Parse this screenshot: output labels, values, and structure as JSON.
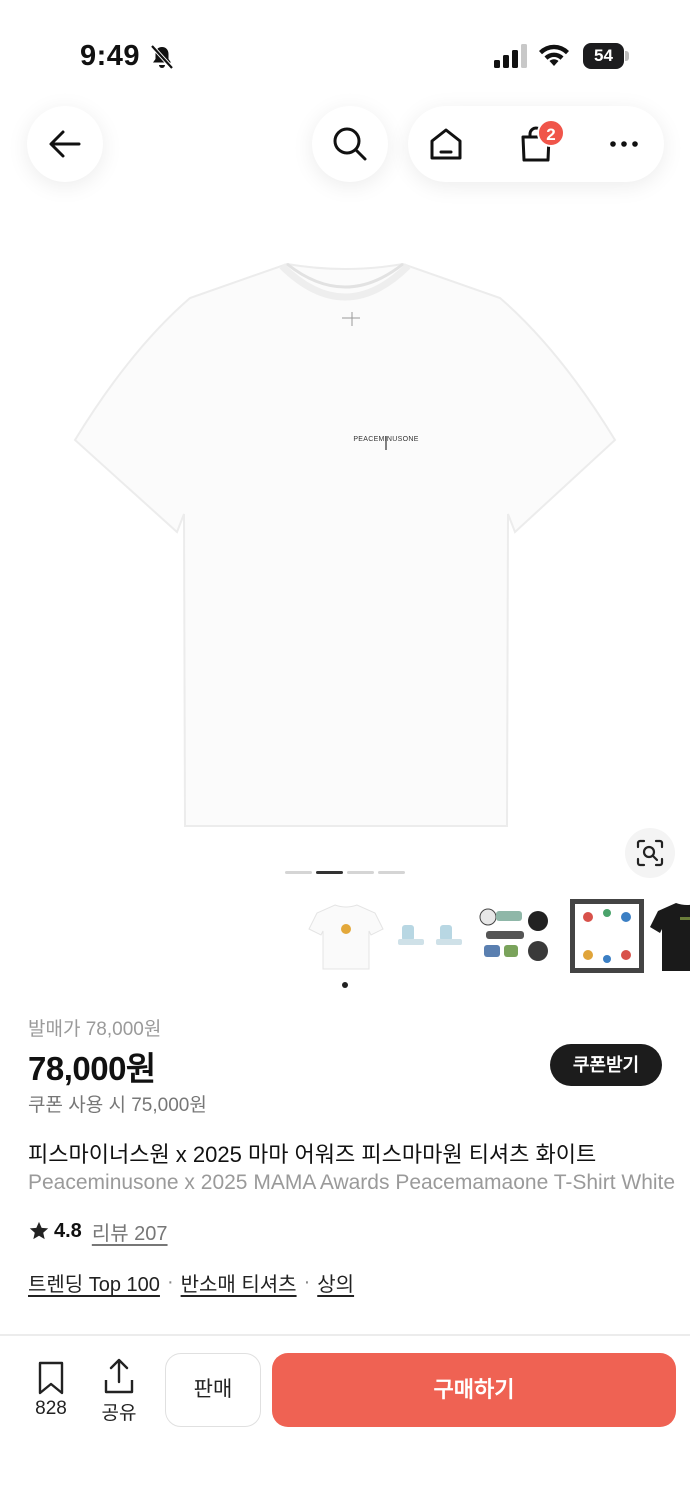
{
  "status_bar": {
    "time": "9:49",
    "battery": "54"
  },
  "nav": {
    "cart_badge": "2"
  },
  "product": {
    "original_price": "발매가 78,000원",
    "price": "78,000원",
    "coupon_button": "쿠폰받기",
    "coupon_price": "쿠폰 사용 시 75,000원",
    "title_ko": "피스마이너스원 x 2025 마마 어워즈 피스마마원 티셔츠 화이트",
    "title_en": "Peaceminusone x 2025 MAMA Awards Peacemamaone T-Shirt White",
    "rating": "4.8",
    "review_link": "리뷰 207",
    "categories": [
      "트렌딩 Top 100",
      "반소매 티셔츠",
      "상의"
    ],
    "category_separator": "·",
    "shirt_print": "PEACEMINUSONE"
  },
  "gallery": {
    "page_count": 4,
    "active_page": 1
  },
  "bottom_bar": {
    "bookmark_count": "828",
    "share_label": "공유",
    "sell_label": "판매",
    "buy_label": "구매하기"
  },
  "colors": {
    "accent": "#ef6253",
    "badge": "#f0554a",
    "dark": "#1c1c1c"
  },
  "icons": [
    "bell-slash-icon",
    "signal-icon",
    "wifi-icon",
    "back-arrow-icon",
    "search-icon",
    "home-icon",
    "shopping-bag-icon",
    "more-icon",
    "visual-search-icon",
    "star-icon",
    "bookmark-icon",
    "share-icon"
  ]
}
